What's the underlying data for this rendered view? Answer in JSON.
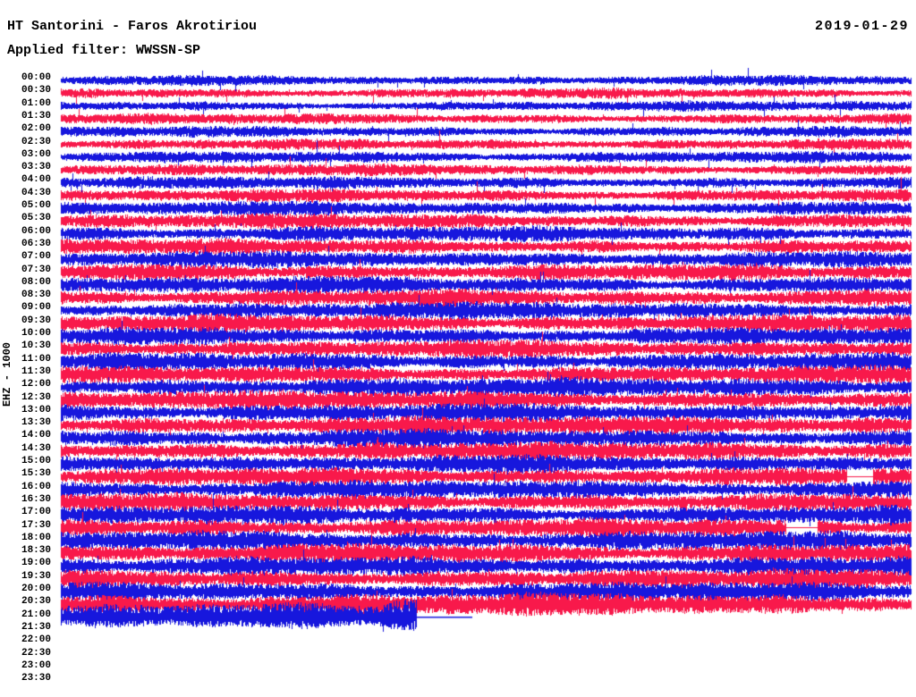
{
  "header": {
    "title": "HT Santorini - Faros Akrotiriou",
    "date": "2019-01-29",
    "filter_label": "Applied filter: WWSSN-SP"
  },
  "axis": {
    "channel_label": "EHZ - 1000"
  },
  "chart_data": {
    "type": "helicorder-seismogram",
    "title": "HT Santorini - Faros Akrotiriou",
    "date": "2019-01-29",
    "applied_filter": "WWSSN-SP",
    "channel": "EHZ",
    "gain_scale": 1000,
    "minutes_per_row": 30,
    "legend_position": "none",
    "grid": false,
    "recording_ends_near": "21:12",
    "colors": {
      "blue": "#1717DD",
      "red": "#F8194B",
      "text": "#000000",
      "background": "#FFFFFF"
    },
    "rows": [
      {
        "t": "00:00",
        "color": "blue",
        "amp": 6.5
      },
      {
        "t": "00:30",
        "color": "red",
        "amp": 6.5
      },
      {
        "t": "01:00",
        "color": "blue",
        "amp": 6.5
      },
      {
        "t": "01:30",
        "color": "red",
        "amp": 6.8
      },
      {
        "t": "02:00",
        "color": "blue",
        "amp": 7.0
      },
      {
        "t": "02:30",
        "color": "red",
        "amp": 7.0
      },
      {
        "t": "03:00",
        "color": "blue",
        "amp": 7.5
      },
      {
        "t": "03:30",
        "color": "red",
        "amp": 7.5
      },
      {
        "t": "04:00",
        "color": "blue",
        "amp": 8.0
      },
      {
        "t": "04:30",
        "color": "red",
        "amp": 8.2
      },
      {
        "t": "05:00",
        "color": "blue",
        "amp": 9.0
      },
      {
        "t": "05:30",
        "color": "red",
        "amp": 9.5
      },
      {
        "t": "06:00",
        "color": "blue",
        "amp": 10.0
      },
      {
        "t": "06:30",
        "color": "red",
        "amp": 10.0
      },
      {
        "t": "07:00",
        "color": "blue",
        "amp": 10.5
      },
      {
        "t": "07:30",
        "color": "red",
        "amp": 10.5
      },
      {
        "t": "08:00",
        "color": "blue",
        "amp": 11.0
      },
      {
        "t": "08:30",
        "color": "red",
        "amp": 11.0
      },
      {
        "t": "09:00",
        "color": "blue",
        "amp": 11.0
      },
      {
        "t": "09:30",
        "color": "red",
        "amp": 11.5
      },
      {
        "t": "10:00",
        "color": "blue",
        "amp": 11.5
      },
      {
        "t": "10:30",
        "color": "red",
        "amp": 11.5
      },
      {
        "t": "11:00",
        "color": "blue",
        "amp": 11.5
      },
      {
        "t": "11:30",
        "color": "red",
        "amp": 11.5
      },
      {
        "t": "12:00",
        "color": "blue",
        "amp": 12.0
      },
      {
        "t": "12:30",
        "color": "red",
        "amp": 12.0
      },
      {
        "t": "13:00",
        "color": "blue",
        "amp": 12.0
      },
      {
        "t": "13:30",
        "color": "red",
        "amp": 12.0
      },
      {
        "t": "14:00",
        "color": "blue",
        "amp": 12.0
      },
      {
        "t": "14:30",
        "color": "red",
        "amp": 12.0
      },
      {
        "t": "15:00",
        "color": "blue",
        "amp": 11.5
      },
      {
        "t": "15:30",
        "color": "red",
        "amp": 11.5,
        "gaps": [
          [
            0.925,
            0.955
          ]
        ]
      },
      {
        "t": "16:00",
        "color": "blue",
        "amp": 12.0
      },
      {
        "t": "16:30",
        "color": "red",
        "amp": 12.0
      },
      {
        "t": "17:00",
        "color": "blue",
        "amp": 12.0
      },
      {
        "t": "17:30",
        "color": "red",
        "amp": 12.0,
        "gaps": [
          [
            0.853,
            0.89
          ]
        ]
      },
      {
        "t": "18:00",
        "color": "blue",
        "amp": 12.5
      },
      {
        "t": "18:30",
        "color": "red",
        "amp": 12.5
      },
      {
        "t": "19:00",
        "color": "blue",
        "amp": 12.5
      },
      {
        "t": "19:30",
        "color": "red",
        "amp": 12.5
      },
      {
        "t": "20:00",
        "color": "blue",
        "amp": 12.5
      },
      {
        "t": "20:30",
        "color": "red",
        "amp": 14.5
      },
      {
        "t": "21:00",
        "color": "blue",
        "amp": 16,
        "amp_up": 18,
        "amp_dn": 14,
        "end": 0.418,
        "flat_to": 0.484,
        "boost": [
          0.368,
          0.418
        ]
      },
      {
        "t": "21:30",
        "color": "red",
        "amp": 0
      },
      {
        "t": "22:00",
        "color": "blue",
        "amp": 0
      },
      {
        "t": "22:30",
        "color": "red",
        "amp": 0
      },
      {
        "t": "23:00",
        "color": "blue",
        "amp": 0
      },
      {
        "t": "23:30",
        "color": "red",
        "amp": 0
      }
    ]
  }
}
